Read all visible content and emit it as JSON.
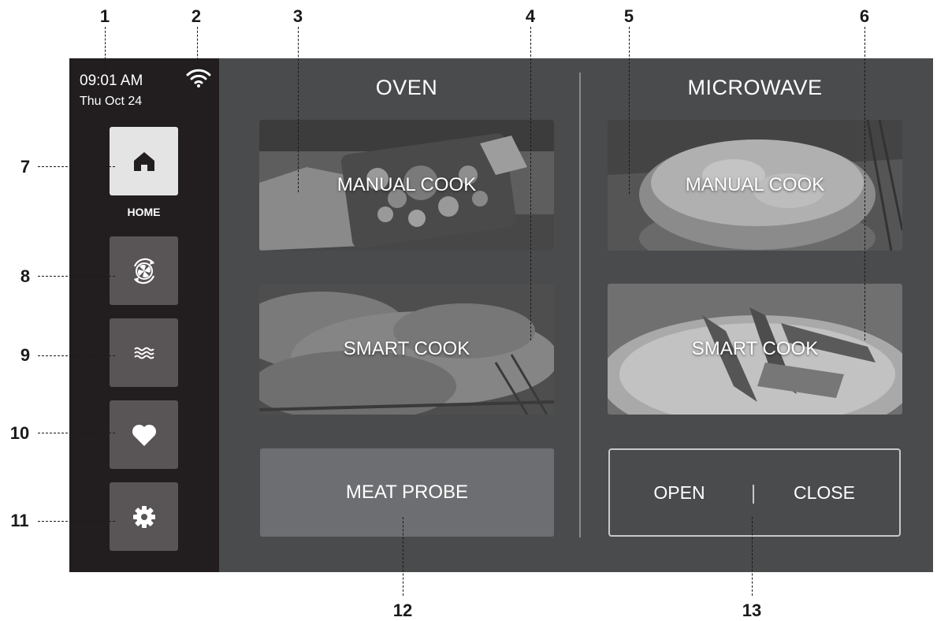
{
  "callouts": [
    "1",
    "2",
    "3",
    "4",
    "5",
    "6",
    "7",
    "8",
    "9",
    "10",
    "11",
    "12",
    "13"
  ],
  "status": {
    "time": "09:01 AM",
    "date": "Thu Oct 24"
  },
  "sidebar": {
    "home_label": "HOME",
    "items": [
      {
        "icon": "home-icon",
        "active": true
      },
      {
        "icon": "convection-fan-icon",
        "active": false
      },
      {
        "icon": "steam-waves-icon",
        "active": false
      },
      {
        "icon": "heart-icon",
        "active": false
      },
      {
        "icon": "gear-icon",
        "active": false
      }
    ]
  },
  "oven": {
    "title": "OVEN",
    "manual_label": "MANUAL COOK",
    "smart_label": "SMART COOK",
    "probe_label": "MEAT PROBE"
  },
  "microwave": {
    "title": "MICROWAVE",
    "manual_label": "MANUAL COOK",
    "smart_label": "SMART COOK",
    "door_open": "OPEN",
    "door_close": "CLOSE"
  },
  "colors": {
    "screen_bg": "#4a4b4d",
    "sidebar_bg": "#221e1f",
    "button_bg": "#595456",
    "active_bg": "#e4e4e4",
    "probe_bg": "#6d6e71"
  }
}
